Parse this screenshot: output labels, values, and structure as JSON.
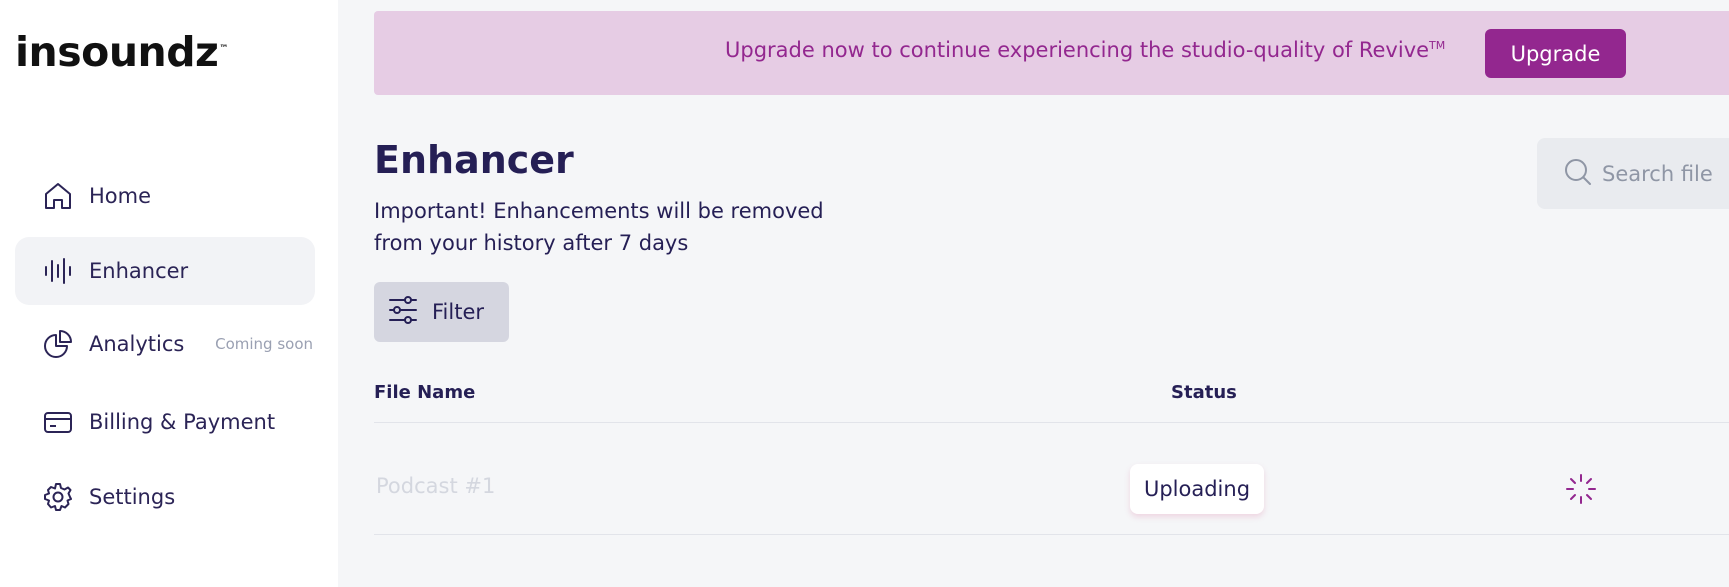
{
  "brand": {
    "name": "insoundz",
    "tm": "™"
  },
  "sidebar": {
    "items": [
      {
        "label": "Home",
        "icon": "home-icon"
      },
      {
        "label": "Enhancer",
        "icon": "waveform-icon",
        "active": true
      },
      {
        "label": "Analytics",
        "icon": "pie-chart-icon",
        "badge": "Coming soon"
      },
      {
        "label": "Billing & Payment",
        "icon": "credit-card-icon"
      },
      {
        "label": "Settings",
        "icon": "gear-icon"
      }
    ]
  },
  "banner": {
    "text": "Upgrade now to continue experiencing the studio-quality of Revive",
    "tm": "TM",
    "button_label": "Upgrade"
  },
  "main": {
    "title": "Enhancer",
    "note": "Important! Enhancements will be removed from your history after 7 days",
    "search_placeholder": "Search file",
    "filter_label": "Filter"
  },
  "table": {
    "headers": {
      "file_name": "File Name",
      "status": "Status"
    },
    "rows": [
      {
        "file_name": "Podcast #1",
        "status": "Uploading"
      }
    ]
  },
  "colors": {
    "accent": "#93278f",
    "banner_bg": "#e6cce4",
    "text_primary": "#251f55"
  }
}
